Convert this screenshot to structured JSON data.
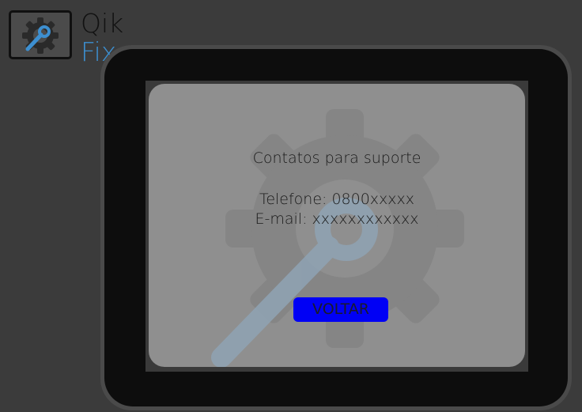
{
  "logo": {
    "line1": "Qik",
    "line2": "Fix",
    "icon": "gear-wrench-icon",
    "accent_color": "#3d8fd0"
  },
  "dialog": {
    "title": "Contatos para suporte",
    "phone": "Telefone: 0800xxxxx",
    "email": "E-mail: xxxxxxxxxxxx",
    "button_label": "VOLTAR",
    "button_color": "#0000f5",
    "watermark_icon": "gear-wrench-icon"
  }
}
